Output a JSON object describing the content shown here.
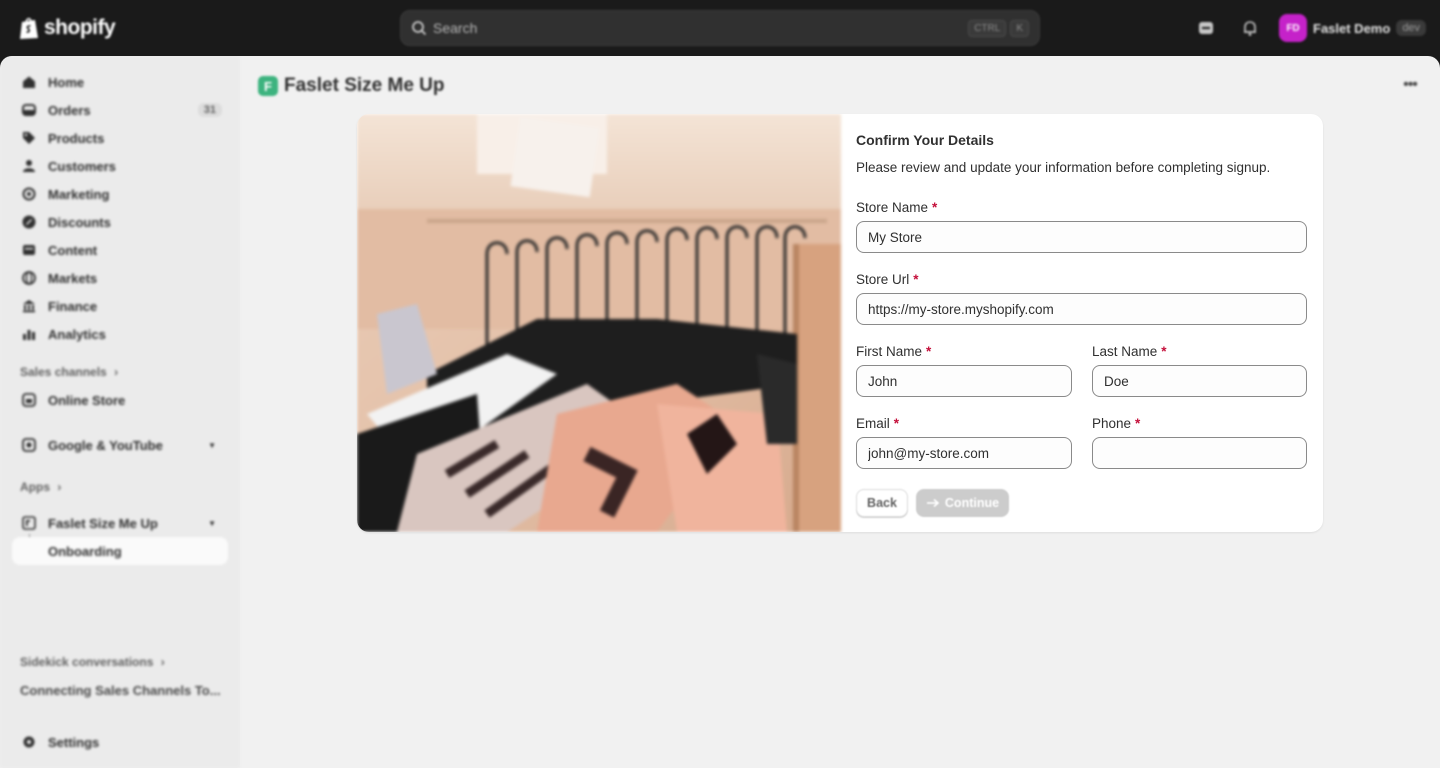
{
  "topbar": {
    "logo_text": "shopify",
    "search_placeholder": "Search",
    "shortcut_keys": [
      "CTRL",
      "K"
    ],
    "user": {
      "initials": "FD",
      "name": "Faslet Demo",
      "badge": "dev",
      "avatar_color": "#c522c9"
    }
  },
  "sidebar": {
    "items": [
      {
        "label": "Home",
        "icon": "home-icon"
      },
      {
        "label": "Orders",
        "icon": "orders-icon",
        "count": "31"
      },
      {
        "label": "Products",
        "icon": "tag-icon"
      },
      {
        "label": "Customers",
        "icon": "person-icon"
      },
      {
        "label": "Marketing",
        "icon": "target-icon"
      },
      {
        "label": "Discounts",
        "icon": "discount-icon"
      },
      {
        "label": "Content",
        "icon": "content-icon"
      },
      {
        "label": "Markets",
        "icon": "globe-icon"
      },
      {
        "label": "Finance",
        "icon": "bank-icon"
      },
      {
        "label": "Analytics",
        "icon": "chart-icon"
      }
    ],
    "sales_channels_label": "Sales channels",
    "online_store_label": "Online Store",
    "google_label": "Google & YouTube",
    "apps_label": "Apps",
    "app_label": "Faslet Size Me Up",
    "app_sub_label": "Onboarding",
    "sidekick_label": "Sidekick conversations",
    "sidekick_item": "Connecting Sales Channels To...",
    "settings_label": "Settings"
  },
  "page": {
    "title": "Faslet Size Me Up",
    "app_icon_letter": "F",
    "more_label": "•••"
  },
  "form": {
    "title": "Confirm Your Details",
    "description": "Please review and update your information before completing signup.",
    "required_marker": "*",
    "store_name": {
      "label": "Store Name",
      "value": "My Store"
    },
    "store_url": {
      "label": "Store Url",
      "value": "https://my-store.myshopify.com"
    },
    "first_name": {
      "label": "First Name",
      "value": "John"
    },
    "last_name": {
      "label": "Last Name",
      "value": "Doe"
    },
    "email": {
      "label": "Email",
      "value": "john@my-store.com"
    },
    "phone": {
      "label": "Phone",
      "value": ""
    },
    "back_label": "Back",
    "continue_label": "Continue"
  },
  "colors": {
    "accent_required": "#c40f3a",
    "topbar": "#1a1a1a",
    "app_icon": "#3db37f",
    "continue_disabled": "#cccccc"
  }
}
